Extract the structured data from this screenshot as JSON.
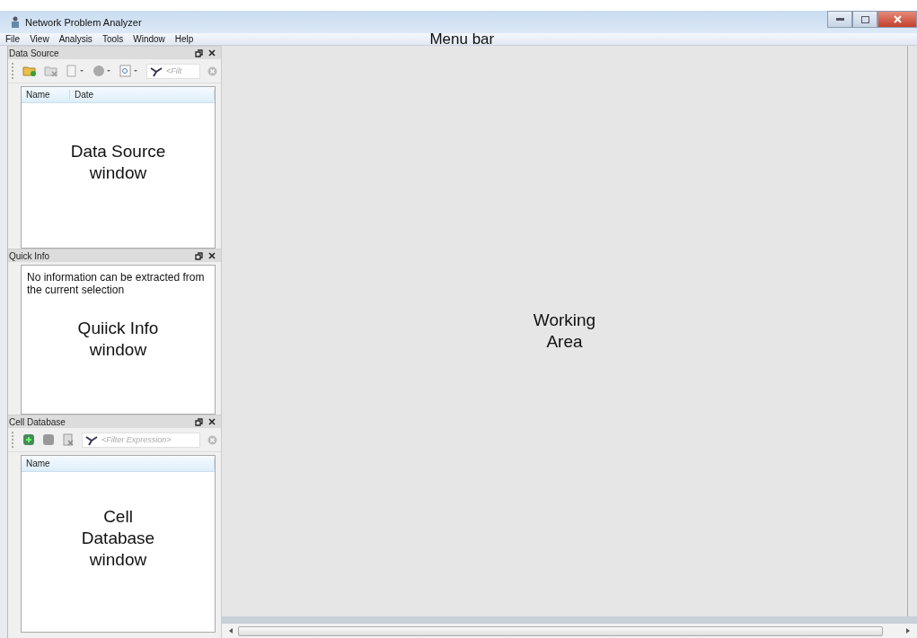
{
  "window": {
    "title": "Network Problem Analyzer"
  },
  "menu_bar": {
    "items": [
      "File",
      "View",
      "Analysis",
      "Tools",
      "Window",
      "Help"
    ],
    "annotation": "Menu bar"
  },
  "panels": [
    {
      "kind": "source_table",
      "title": "Data Source",
      "toolbar": {
        "filter_placeholder": "<Filt"
      },
      "columns": [
        "Name",
        "Date"
      ],
      "annotation": "Data Source\nwindow"
    },
    {
      "kind": "text",
      "title": "Quick Info",
      "text": "No information can be extracted from the current selection",
      "annotation": "Quiick Info\nwindow"
    },
    {
      "kind": "cell_table",
      "title": "Cell Database",
      "toolbar": {
        "filter_placeholder": "<Filter Expression>"
      },
      "columns": [
        "Name"
      ],
      "annotation": "Cell\nDatabase\nwindow"
    }
  ],
  "working_area": {
    "annotation": "Working\nArea"
  }
}
